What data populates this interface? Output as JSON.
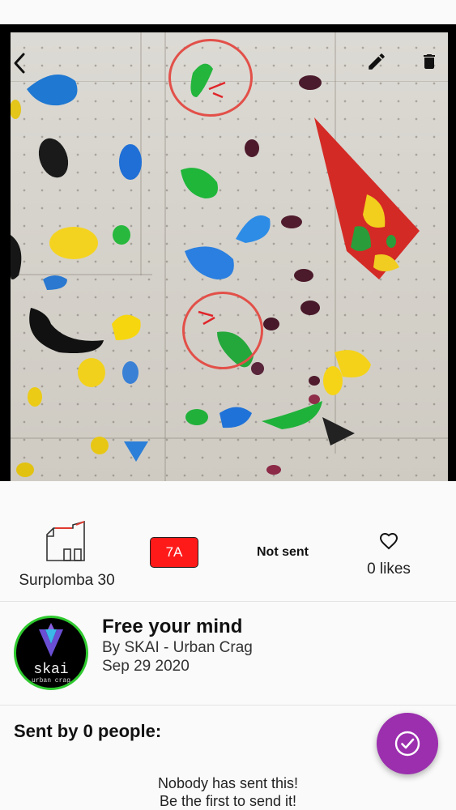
{
  "photo": {
    "back_icon": "chevron-left-icon",
    "edit_icon": "pencil-icon",
    "delete_icon": "trash-icon"
  },
  "info": {
    "wall_icon": "wall-outline-icon",
    "wall_name": "Surplomba 30",
    "grade": "7A",
    "grade_color": "#ff1a1a",
    "sent_status": "Not sent",
    "like_icon": "heart-outline-icon",
    "likes_label": "0 likes"
  },
  "route": {
    "avatar_text": "skai",
    "avatar_subtext": "urban crag",
    "title": "Free your mind",
    "author": "By SKAI - Urban Crag",
    "date": "Sep 29 2020"
  },
  "sends": {
    "heading": "Sent by 0 people:",
    "empty_line1": "Nobody has sent this!",
    "empty_line2": "Be the first to send it!"
  },
  "fab": {
    "icon": "check-circle-icon",
    "color": "#9b2fae"
  }
}
